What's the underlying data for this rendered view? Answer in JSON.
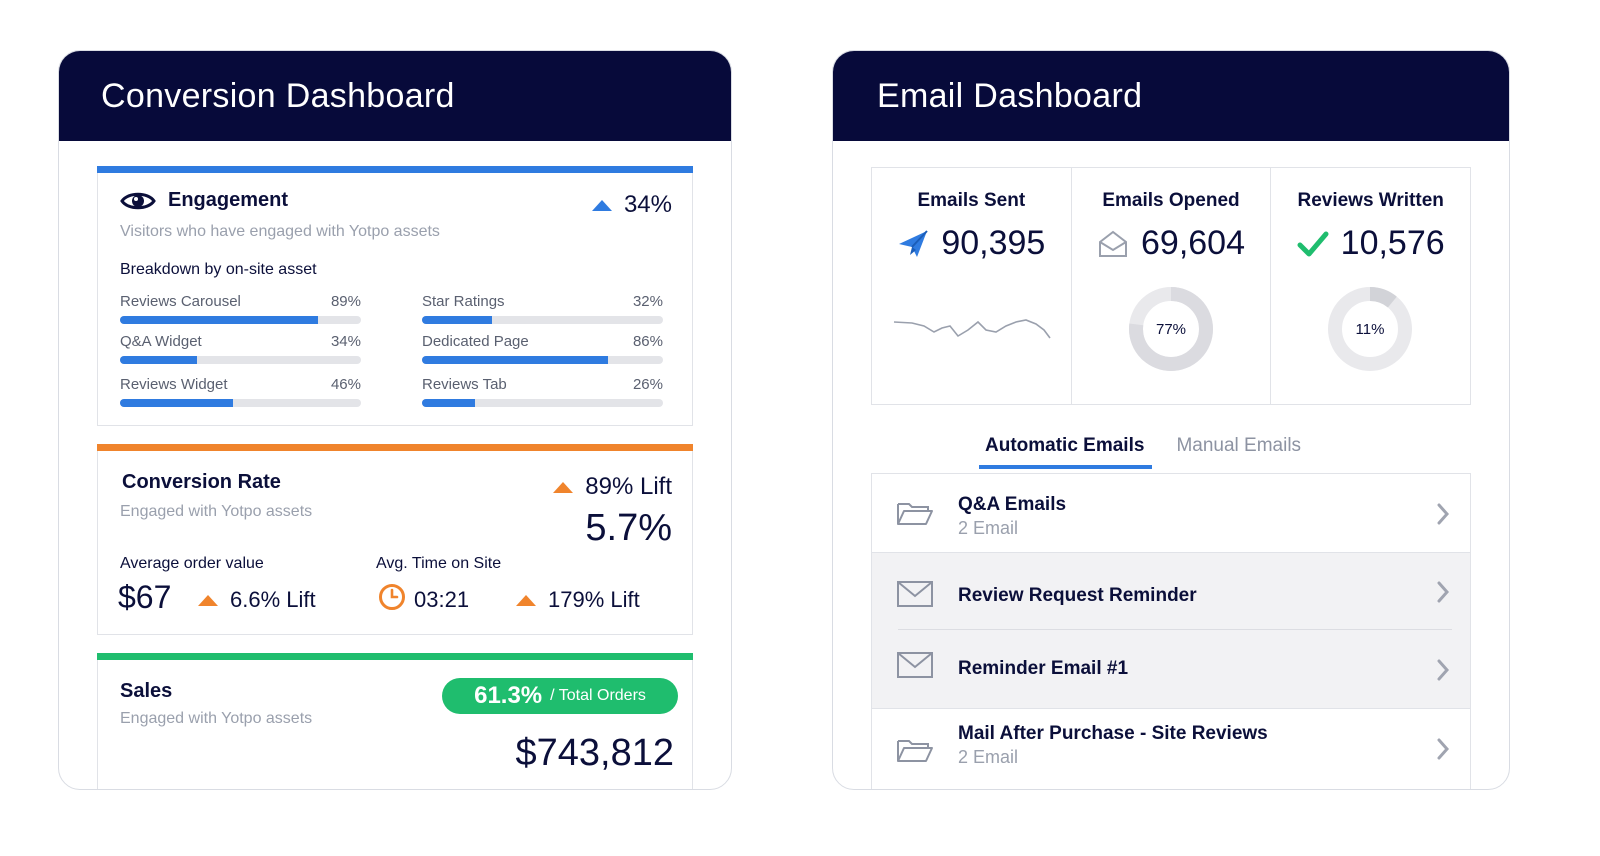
{
  "conversion": {
    "title": "Conversion Dashboard",
    "engagement": {
      "title": "Engagement",
      "subtitle": "Visitors who have engaged with Yotpo assets",
      "change": "34%",
      "breakdown_label": "Breakdown by on-site asset",
      "assets": [
        {
          "label": "Reviews Carousel",
          "value": "89%",
          "fraction": 0.82
        },
        {
          "label": "Star Ratings",
          "value": "32%",
          "fraction": 0.29
        },
        {
          "label": "Q&A Widget",
          "value": "34%",
          "fraction": 0.32
        },
        {
          "label": "Dedicated Page",
          "value": "86%",
          "fraction": 0.77
        },
        {
          "label": "Reviews Widget",
          "value": "46%",
          "fraction": 0.47
        },
        {
          "label": "Reviews Tab",
          "value": "26%",
          "fraction": 0.22
        }
      ],
      "accent": "#2f7be0"
    },
    "conversion_rate": {
      "title": "Conversion Rate",
      "subtitle": "Engaged with Yotpo assets",
      "lift": "89% Lift",
      "rate": "5.7%",
      "aov_label": "Average order value",
      "aov": "$67",
      "aov_lift": "6.6% Lift",
      "time_label": "Avg. Time on Site",
      "time": "03:21",
      "time_lift": "179% Lift",
      "accent": "#f0842c"
    },
    "sales": {
      "title": "Sales",
      "subtitle": "Engaged with Yotpo assets",
      "pill_value": "61.3%",
      "pill_label": "/ Total Orders",
      "amount": "$743,812",
      "accent": "#1fbd6e"
    }
  },
  "email": {
    "title": "Email Dashboard",
    "stats": [
      {
        "title": "Emails Sent",
        "value": "90,395",
        "icon": "paper-plane-icon"
      },
      {
        "title": "Emails Opened",
        "value": "69,604",
        "icon": "open-envelope-icon",
        "donut_label": "77%",
        "donut_fraction": 0.77
      },
      {
        "title": "Reviews Written",
        "value": "10,576",
        "icon": "check-icon",
        "donut_label": "11%",
        "donut_fraction": 0.11
      }
    ],
    "tabs": [
      "Automatic Emails",
      "Manual Emails"
    ],
    "active_tab": "Automatic Emails",
    "items": [
      {
        "title": "Q&A Emails",
        "subtitle": "2 Email",
        "icon": "folder-icon"
      },
      {
        "title": "Review Request Reminder",
        "icon": "envelope-icon"
      },
      {
        "title": "Reminder Email #1",
        "icon": "envelope-icon"
      },
      {
        "title": "Mail After Purchase - Site Reviews",
        "subtitle": "2 Email",
        "icon": "folder-icon"
      }
    ]
  }
}
